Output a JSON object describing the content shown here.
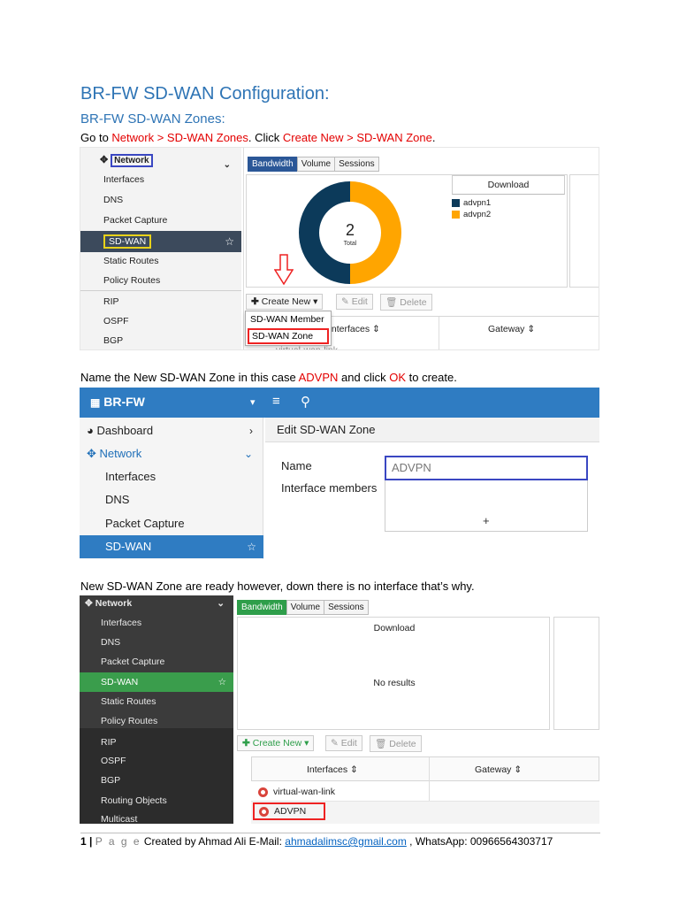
{
  "doc": {
    "heading": "BR-FW SD-WAN Configuration:",
    "subheading": "BR-FW SD-WAN Zones:",
    "p1": {
      "a": "Go to ",
      "b": "Network > SD-WAN Zones",
      "c": ". Click ",
      "d": "Create New > SD-WAN Zone",
      "e": "."
    },
    "p2": {
      "a": "Name the New SD-WAN Zone in this case ",
      "b": "ADVPN",
      "c": " and click ",
      "d": "OK",
      "e": " to create."
    },
    "p3": "New SD-WAN Zone are ready however, down there is no interface that’s why."
  },
  "shot1": {
    "sidebar": {
      "network": "Network",
      "items": [
        "Interfaces",
        "DNS",
        "Packet Capture",
        "SD-WAN",
        "Static Routes",
        "Policy Routes",
        "RIP",
        "OSPF",
        "BGP"
      ]
    },
    "tabs": [
      "Bandwidth",
      "Volume",
      "Sessions"
    ],
    "donut": {
      "center_value": "2",
      "center_label": "Total",
      "slices": [
        {
          "name": "advpn1",
          "fraction": 0.5,
          "color": "#0c3a5a"
        },
        {
          "name": "advpn2",
          "fraction": 0.5,
          "color": "#FFA500"
        }
      ]
    },
    "legend_title": "Download",
    "toolbar": {
      "create": "Create New",
      "edit": "Edit",
      "delete": "Delete"
    },
    "dropdown": [
      "SD-WAN Member",
      "SD-WAN Zone"
    ],
    "columns": {
      "interfaces": "Interfaces",
      "gateway": "Gateway"
    },
    "cut_row": "virtual-wan-link"
  },
  "shot2": {
    "brand": "BR-FW",
    "sidebar": [
      "Dashboard",
      "Network",
      "Interfaces",
      "DNS",
      "Packet Capture",
      "SD-WAN"
    ],
    "title": "Edit SD-WAN Zone",
    "name_label": "Name",
    "name_value": "ADVPN",
    "members_label": "Interface members",
    "add_symbol": "+"
  },
  "shot3": {
    "sidebar": {
      "network": "Network",
      "items": [
        "Interfaces",
        "DNS",
        "Packet Capture",
        "SD-WAN",
        "Static Routes",
        "Policy Routes",
        "RIP",
        "OSPF",
        "BGP",
        "Routing Objects",
        "Multicast"
      ]
    },
    "tabs": [
      "Bandwidth",
      "Volume",
      "Sessions"
    ],
    "download": "Download",
    "no_results": "No results",
    "toolbar": {
      "create": "Create New",
      "edit": "Edit",
      "delete": "Delete"
    },
    "columns": {
      "interfaces": "Interfaces",
      "gateway": "Gateway"
    },
    "rows": [
      "virtual-wan-link",
      "ADVPN"
    ]
  },
  "footer": {
    "page": "1",
    "sep": " | ",
    "page_word": "P a g e",
    "created": "  Created by Ahmad Ali E-Mail: ",
    "email": "ahmadalimsc@gmail.com",
    "whatsapp": " , WhatsApp: 00966564303717"
  }
}
